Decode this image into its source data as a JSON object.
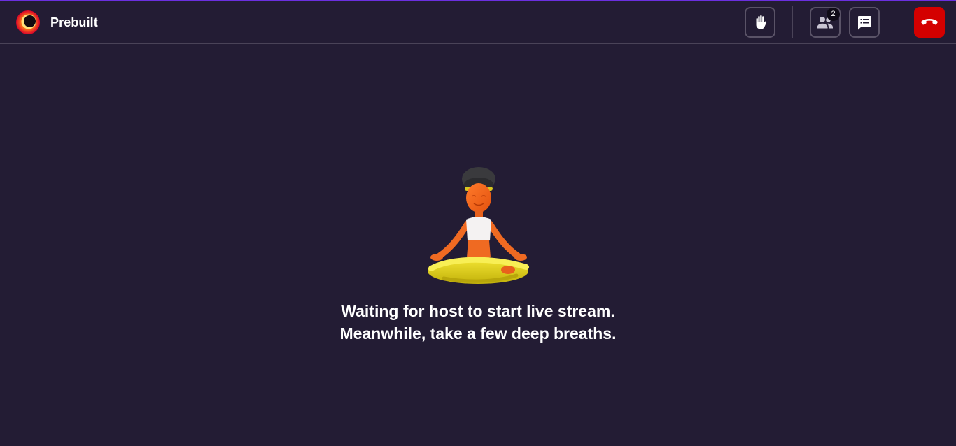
{
  "app": {
    "title": "Prebuilt"
  },
  "header": {
    "actions": {
      "raise_hand": {
        "icon": "raise-hand-icon"
      },
      "participants": {
        "icon": "participants-icon",
        "count": "2"
      },
      "chat": {
        "icon": "chat-icon"
      },
      "leave": {
        "icon": "phone-hangup-icon",
        "color": "#d40000"
      }
    }
  },
  "main": {
    "illustration": "meditating-person",
    "message_line1": "Waiting for host to start live stream.",
    "message_line2": "Meanwhile, take a few deep breaths."
  },
  "colors": {
    "background": "#231c34",
    "accent": "#6b2fe0",
    "leave": "#d40000"
  }
}
